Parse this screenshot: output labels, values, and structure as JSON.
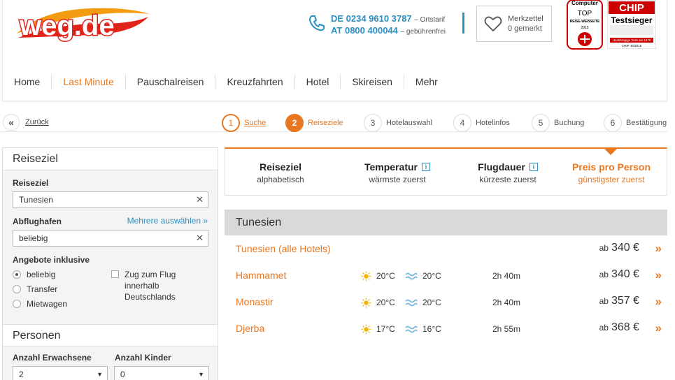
{
  "header": {
    "logo_text": "weg.de",
    "phone_de": "DE 0234 9610 3787",
    "phone_de_note": "– Ortstarif",
    "phone_at": "AT 0800 400044",
    "phone_at_note": "– gebührenfrei",
    "memo_title": "Merkzettel",
    "memo_count": "0 gemerkt",
    "badge1_lines": [
      "Computer",
      "TOP",
      "REISE-WEBSEITE",
      "2015"
    ],
    "badge2_lines": [
      "CHIP",
      "Testsieger",
      "Unabhängige Tests seit 1978",
      "CHIP 10/2015"
    ]
  },
  "nav": [
    "Home",
    "Last Minute",
    "Pauschalreisen",
    "Kreuzfahrten",
    "Hotel",
    "Skireisen",
    "Mehr"
  ],
  "steps": {
    "back_label": "Zurück",
    "items": [
      {
        "num": "1",
        "label": "Suche"
      },
      {
        "num": "2",
        "label": "Reiseziele"
      },
      {
        "num": "3",
        "label": "Hotelauswahl"
      },
      {
        "num": "4",
        "label": "Hotelinfos"
      },
      {
        "num": "5",
        "label": "Buchung"
      },
      {
        "num": "6",
        "label": "Bestätigung"
      }
    ]
  },
  "sidebar": {
    "section1_title": "Reiseziel",
    "destination_label": "Reiseziel",
    "destination_value": "Tunesien",
    "airport_label": "Abflughafen",
    "airport_more": "Mehrere auswählen »",
    "airport_value": "beliebig",
    "included_label": "Angebote inklusive",
    "radios": [
      "beliebig",
      "Transfer",
      "Mietwagen"
    ],
    "checkbox_label": "Zug zum Flug innerhalb Deutschlands",
    "section2_title": "Personen",
    "adults_label": "Anzahl Erwachsene",
    "adults_value": "2",
    "children_label": "Anzahl Kinder",
    "children_value": "0"
  },
  "sort": [
    {
      "title": "Reiseziel",
      "sub": "alphabetisch"
    },
    {
      "title": "Temperatur",
      "sub": "wärmste zuerst"
    },
    {
      "title": "Flugdauer",
      "sub": "kürzeste zuerst"
    },
    {
      "title": "Preis pro Person",
      "sub": "günstigster zuerst"
    }
  ],
  "results": {
    "country": "Tunesien",
    "all_hotels_label": "Tunesien (alle Hotels)",
    "all_hotels_price": "340 €",
    "price_prefix": "ab",
    "rows": [
      {
        "name": "Hammamet",
        "air": "20°C",
        "water": "20°C",
        "duration": "2h 40m",
        "price": "340 €"
      },
      {
        "name": "Monastir",
        "air": "20°C",
        "water": "20°C",
        "duration": "2h 40m",
        "price": "357 €"
      },
      {
        "name": "Djerba",
        "air": "17°C",
        "water": "16°C",
        "duration": "2h 55m",
        "price": "368 €"
      }
    ]
  },
  "colors": {
    "accent": "#e87722",
    "blue": "#2e8fc2",
    "logo_red": "#e2231a"
  }
}
